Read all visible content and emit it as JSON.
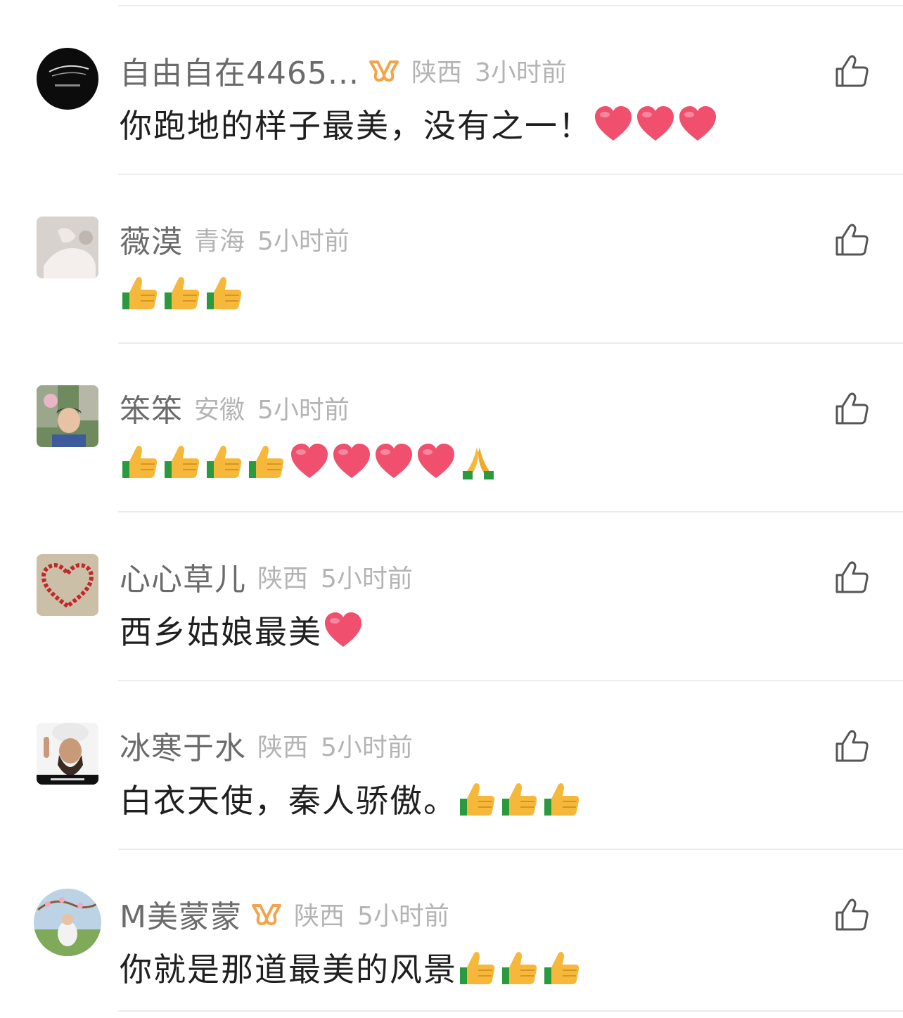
{
  "comments": [
    {
      "username": "自由自在4465...",
      "vip": true,
      "location": "陕西",
      "time": "3小时前",
      "text": "你跑地的样子最美，没有之一！",
      "emojis": [
        "heart-emoji",
        "heart-emoji",
        "heart-emoji"
      ],
      "avatar": "dark-logo-avatar"
    },
    {
      "username": "薇漠",
      "vip": false,
      "location": "青海",
      "time": "5小时前",
      "text": "",
      "emojis": [
        "thumbs-up-emoji",
        "thumbs-up-emoji",
        "thumbs-up-emoji"
      ],
      "avatar": "hands-photo-avatar"
    },
    {
      "username": "笨笨",
      "vip": false,
      "location": "安徽",
      "time": "5小时前",
      "text": "",
      "emojis": [
        "thumbs-up-emoji",
        "thumbs-up-emoji",
        "thumbs-up-emoji",
        "thumbs-up-emoji",
        "heart-emoji",
        "heart-emoji",
        "heart-emoji",
        "heart-emoji",
        "folded-hands-emoji"
      ],
      "avatar": "man-portrait-avatar"
    },
    {
      "username": "心心草儿",
      "vip": false,
      "location": "陕西",
      "time": "5小时前",
      "text": "西乡姑娘最美",
      "emojis": [
        "heart-emoji"
      ],
      "avatar": "heart-shape-avatar"
    },
    {
      "username": "冰寒于水",
      "vip": false,
      "location": "陕西",
      "time": "5小时前",
      "text": "白衣天使，秦人骄傲。",
      "emojis": [
        "thumbs-up-emoji",
        "thumbs-up-emoji",
        "thumbs-up-emoji"
      ],
      "avatar": "man-turban-avatar"
    },
    {
      "username": "M美蒙蒙",
      "vip": true,
      "location": "陕西",
      "time": "5小时前",
      "text": "你就是那道最美的风景",
      "emojis": [
        "thumbs-up-emoji",
        "thumbs-up-emoji",
        "thumbs-up-emoji"
      ],
      "avatar": "garden-photo-avatar"
    }
  ],
  "colors": {
    "username": "#6b6b6b",
    "meta": "#b4b4b4",
    "text": "#1f1f1f",
    "vip_badge": "#f5a34a",
    "divider": "#ececec",
    "heart": "#f0506e",
    "thumb": "#f6b83a"
  }
}
